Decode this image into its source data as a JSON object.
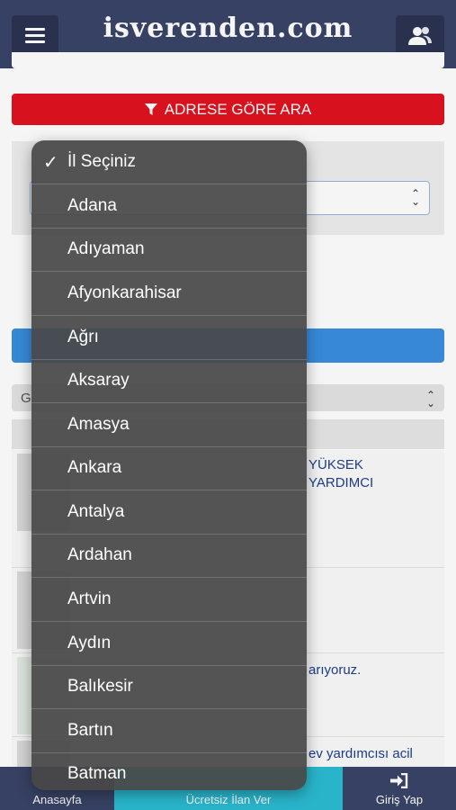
{
  "header": {
    "brand": "isverenden.com",
    "menu_icon": "hamburger-icon",
    "user_icon": "users-icon"
  },
  "filter": {
    "address_search_label": "ADRESE GÖRE ARA",
    "filter_icon": "funnel-icon"
  },
  "sort": {
    "visible_text": "G"
  },
  "listing": {
    "items": [
      {
        "line1": "YÜKSEK",
        "line2": "YARDIMCI"
      },
      {
        "line1": "",
        "line2": ""
      },
      {
        "line1": "arıyoruz.",
        "line2": ""
      },
      {
        "line1": "ev yardımcısı acil",
        "line2": ""
      }
    ]
  },
  "province_dropdown": {
    "selected": "İl Seçiniz",
    "options": [
      "İl Seçiniz",
      "Adana",
      "Adıyaman",
      "Afyonkarahisar",
      "Ağrı",
      "Aksaray",
      "Amasya",
      "Ankara",
      "Antalya",
      "Ardahan",
      "Artvin",
      "Aydın",
      "Balıkesir",
      "Bartın",
      "Batman"
    ]
  },
  "bottom_nav": {
    "home_label": "Anasayfa",
    "post_label": "Ücretsiz İlan Ver",
    "login_label": "Giriş Yap",
    "login_icon": "sign-in-icon"
  },
  "colors": {
    "header_bg": "#3a4468",
    "primary_red": "#e0121f",
    "primary_blue": "#3a8fe0",
    "accent_teal": "#2bbcd3"
  }
}
